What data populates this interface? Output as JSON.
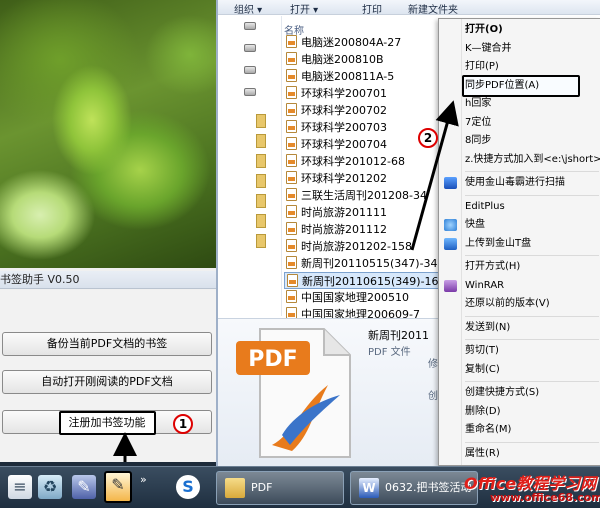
{
  "app": {
    "title": "书签助手 V0.50",
    "buttons": [
      {
        "label": "备份当前PDF文档的书签"
      },
      {
        "label": "自动打开刚阅读的PDF文档"
      },
      {
        "label": "注册加书签功能"
      }
    ]
  },
  "explorer": {
    "toolbar": {
      "organize": "组织 ▾",
      "open": "打开 ▾",
      "print": "打印",
      "new_folder": "新建文件夹"
    },
    "column_header": "名称",
    "files": [
      "电脑迷200804A-27",
      "电脑迷200810B",
      "电脑迷200811A-5",
      "环球科学200701",
      "环球科学200702",
      "环球科学200703",
      "环球科学200704",
      "环球科学201012-68",
      "环球科学201202",
      "三联生活周刊201208-34",
      "时尚旅游201111",
      "时尚旅游201112",
      "时尚旅游201202-158",
      "新周刊20110515(347)-34",
      "新周刊20110615(349)-160",
      "中国国家地理200510",
      "中国国家地理200609-7"
    ],
    "selected_index": 14,
    "details": {
      "name": "新周刊2011",
      "type": "PDF 文件",
      "meta1": "修",
      "meta2": "创",
      "icon_label": "PDF"
    }
  },
  "context_menu": {
    "items": [
      {
        "label": "打开(O)",
        "bold": true,
        "icon": ""
      },
      {
        "label": "K—键合并",
        "icon": ""
      },
      {
        "label": "打印(P)",
        "icon": ""
      },
      {
        "label": "同步PDF位置(A)",
        "icon": "",
        "highlighted": true
      },
      {
        "label": "h回家",
        "icon": ""
      },
      {
        "label": "7定位",
        "icon": ""
      },
      {
        "label": "8同步",
        "icon": ""
      },
      {
        "label": "z.快捷方式加入到<e:\\jshort>",
        "icon": ""
      },
      {
        "label": "使用金山毒霸进行扫描",
        "icon": "kingsoft-antivirus-icon"
      },
      {
        "label": "EditPlus",
        "icon": ""
      },
      {
        "label": "快盘",
        "icon": "kuaipan-icon"
      },
      {
        "label": "上传到金山T盘",
        "icon": "kingsoft-tdisk-icon"
      },
      {
        "label": "打开方式(H)",
        "icon": ""
      },
      {
        "label": "WinRAR",
        "icon": "winrar-icon"
      },
      {
        "label": "还原以前的版本(V)",
        "icon": ""
      },
      {
        "label": "发送到(N)",
        "icon": ""
      },
      {
        "label": "剪切(T)",
        "icon": ""
      },
      {
        "label": "复制(C)",
        "icon": ""
      },
      {
        "label": "创建快捷方式(S)",
        "icon": ""
      },
      {
        "label": "删除(D)",
        "icon": ""
      },
      {
        "label": "重命名(M)",
        "icon": ""
      },
      {
        "label": "属性(R)",
        "icon": ""
      }
    ]
  },
  "taskbar": {
    "icons": [
      "notepad-icon",
      "recycle-bin-icon",
      "document-tool-icon",
      "bookmark-helper-icon",
      "search-app-icon"
    ],
    "overflow": "»",
    "buttons": [
      {
        "label": "PDF",
        "icon": "folder-icon"
      },
      {
        "label": "0632.把书签活动",
        "icon": "word-icon"
      }
    ]
  },
  "markers": {
    "one": "1",
    "two": "2"
  },
  "watermark": {
    "line1": "Office教程学习网",
    "line2": "www.office68.com"
  },
  "colors": {
    "marker_ring": "#d00000",
    "watermark": "#e0201a",
    "selection": "#d7e8fb"
  }
}
